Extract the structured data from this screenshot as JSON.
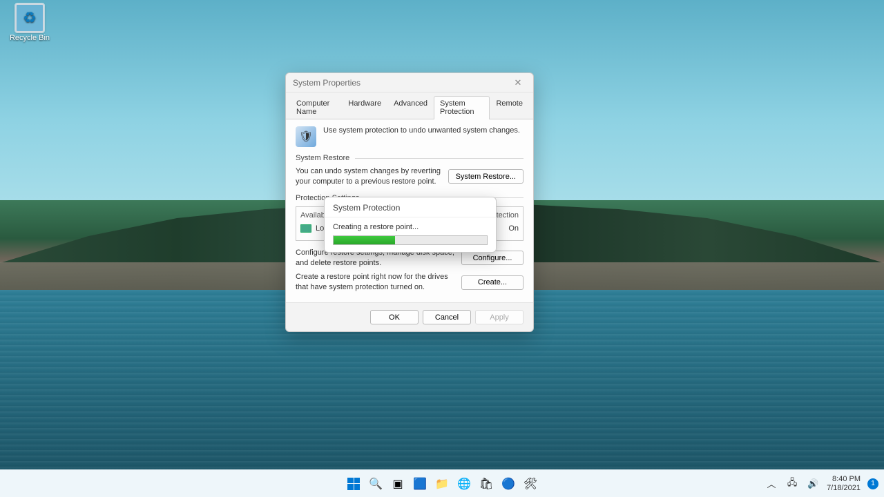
{
  "desktop": {
    "recycle_bin_label": "Recycle Bin"
  },
  "dialog": {
    "title": "System Properties",
    "tabs": {
      "computer_name": "Computer Name",
      "hardware": "Hardware",
      "advanced": "Advanced",
      "system_protection": "System Protection",
      "remote": "Remote"
    },
    "intro_text": "Use system protection to undo unwanted system changes.",
    "section_restore": "System Restore",
    "restore_desc": "You can undo system changes by reverting your computer to a previous restore point.",
    "restore_button": "System Restore...",
    "section_settings": "Protection Settings",
    "drive_header_drives": "Available Drives",
    "drive_header_protection": "Protection",
    "drive_name": "Local Disk (C:) (System)",
    "drive_status": "On",
    "configure_desc": "Configure restore settings, manage disk space, and delete restore points.",
    "configure_button": "Configure...",
    "create_desc": "Create a restore point right now for the drives that have system protection turned on.",
    "create_button": "Create...",
    "ok_button": "OK",
    "cancel_button": "Cancel",
    "apply_button": "Apply"
  },
  "progress": {
    "title": "System Protection",
    "message": "Creating a restore point...",
    "percent": 40
  },
  "taskbar": {
    "time": "8:40 PM",
    "date": "7/18/2021",
    "notif_count": "1"
  }
}
